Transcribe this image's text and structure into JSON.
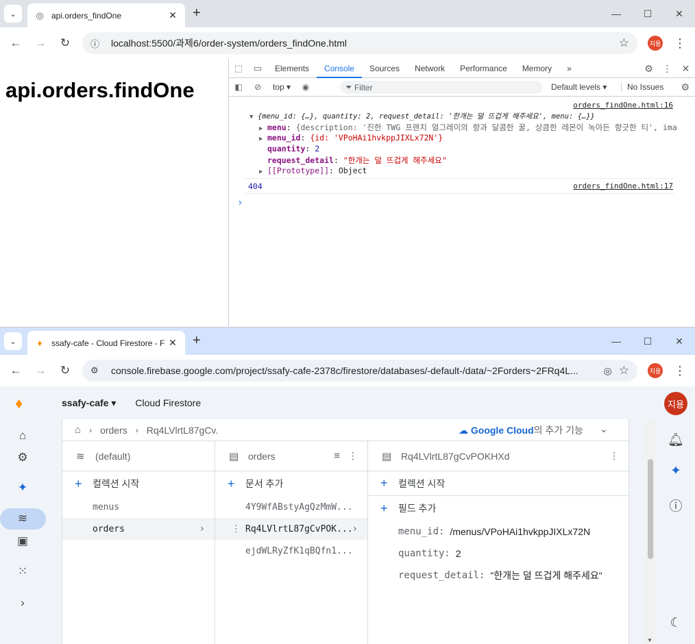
{
  "window1": {
    "tab_title": "api.orders_findOne",
    "url": "localhost:5500/과제6/order-system/orders_findOne.html",
    "profile": "지용",
    "page_heading": "api.orders.findOne",
    "devtools": {
      "tabs": [
        "Elements",
        "Console",
        "Sources",
        "Network",
        "Performance",
        "Memory"
      ],
      "active_tab": "Console",
      "more": "»",
      "context": "top ▾",
      "filter_placeholder": "Filter",
      "levels": "Default levels ▾",
      "issues": "No Issues",
      "console": {
        "link1": "orders_findOne.html:16",
        "summary": "{menu_id: {…}, quantity: 2, request_detail: '한개는 덜 뜨겁게 해주세요', menu: {…}}",
        "menu_line_key": "menu",
        "menu_line_value": "{description: '진한 TWG 프렌치 얼그레이의 향과 달콤한 꿀, 상큼한 레몬이 녹아든 향긋한 티', ima",
        "menu_id_key": "menu_id",
        "menu_id_value": "{id: 'VPoHAi1hvkppJIXLx72N'}",
        "quantity_key": "quantity",
        "quantity_value": "2",
        "request_key": "request_detail",
        "request_value": "\"한개는 덜 뜨겁게 해주세요\"",
        "proto_key": "[[Prototype]]",
        "proto_value": "Object",
        "status": "404",
        "link2": "orders_findOne.html:17",
        "prompt": "›"
      }
    }
  },
  "window2": {
    "tab_title": "ssafy-cafe - Cloud Firestore - F",
    "url": "console.firebase.google.com/project/ssafy-cafe-2378c/firestore/databases/-default-/data/~2Forders~2FRq4L...",
    "profile": "지용",
    "project": "ssafy-cafe ▾",
    "product": "Cloud Firestore",
    "avatar": "지용",
    "breadcrumb": {
      "collection": "orders",
      "doc": "Rq4LVlrtL87gCv.",
      "gc_brand": "Google Cloud",
      "gc_rest": "의 추가 기능"
    },
    "col1": {
      "title": "(default)",
      "add": "컬렉션 시작",
      "items": [
        "menus",
        "orders"
      ]
    },
    "col2": {
      "title": "orders",
      "add": "문서 추가",
      "items": [
        "4Y9WfABstyAgQzMmW...",
        "Rq4LVlrtL87gCvPOK...",
        "ejdWLRyZfK1qBQfn1..."
      ]
    },
    "col3": {
      "title": "Rq4LVlrtL87gCvPOKHXd",
      "add_collection": "컬렉션 시작",
      "add_field": "필드 추가",
      "fields": [
        {
          "key": "menu_id:",
          "value": "/menus/VPoHAi1hvkppJIXLx72N"
        },
        {
          "key": "quantity:",
          "value": "2"
        },
        {
          "key": "request_detail:",
          "value": "\"한개는 덜 뜨겁게 해주세요\""
        }
      ]
    }
  }
}
